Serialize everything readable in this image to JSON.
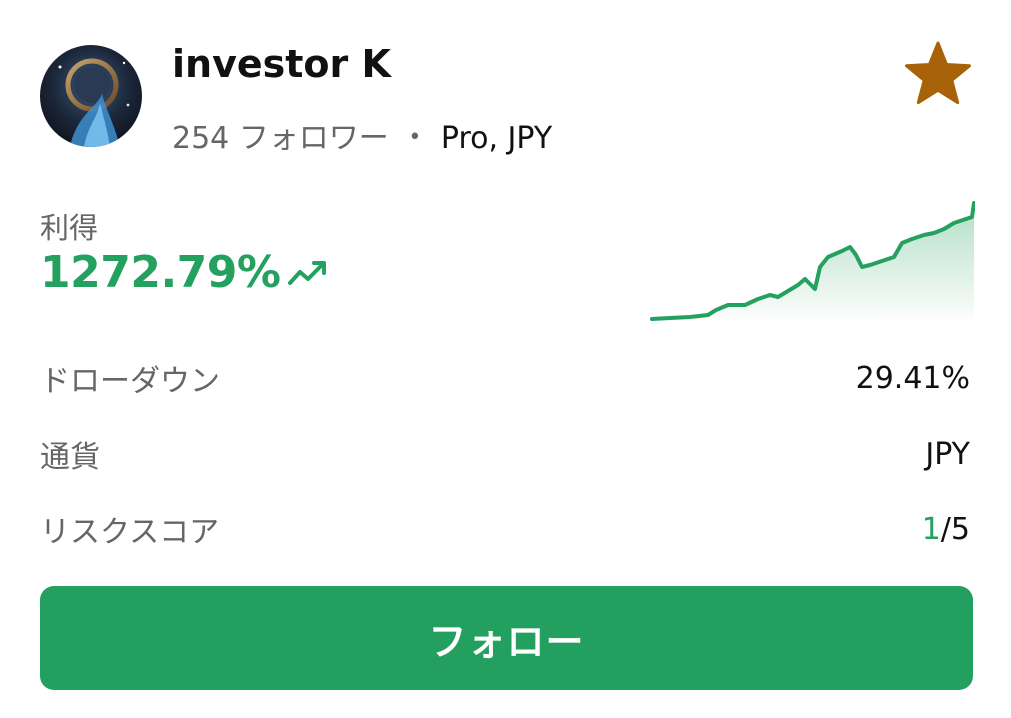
{
  "trader": {
    "name": "investor K",
    "follower_count": "254",
    "followers_label": "フォロワー",
    "separator": "•",
    "plan": "Pro, JPY",
    "favorite_icon": "star-icon",
    "favorite_color": "#a8630a"
  },
  "profit": {
    "label": "利得",
    "value": "1272.79%",
    "trend_icon": "trending-up-icon",
    "color": "#24a05f"
  },
  "stats": {
    "drawdown": {
      "label": "ドローダウン",
      "value": "29.41%"
    },
    "currency": {
      "label": "通貨",
      "value": "JPY"
    },
    "risk": {
      "label": "リスクスコア",
      "score": "1",
      "max": "/5"
    }
  },
  "follow_button": {
    "label": "フォロー",
    "color": "#23a05f"
  }
}
